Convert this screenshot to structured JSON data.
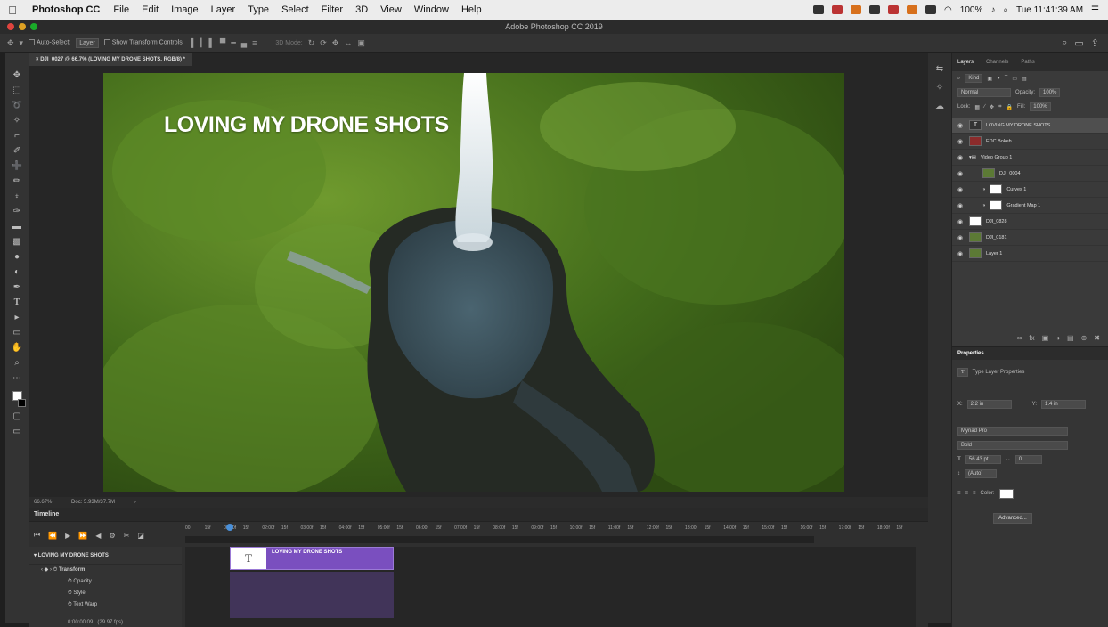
{
  "menubar": {
    "apple": "",
    "app_name": "Photoshop CC",
    "menus": [
      "File",
      "Edit",
      "Image",
      "Layer",
      "Type",
      "Select",
      "Filter",
      "3D",
      "View",
      "Window",
      "Help"
    ],
    "battery": "100%",
    "clock": "Tue 11:41:39 AM"
  },
  "window": {
    "title": "Adobe Photoshop CC 2019"
  },
  "options_bar": {
    "auto_select_label": "Auto-Select:",
    "auto_select_value": "Layer",
    "show_transform_label": "Show Transform Controls",
    "mode_3d": "3D Mode:"
  },
  "document_tab": {
    "title": "DJI_0027 @ 66.7% (LOVING MY DRONE SHOTS, RGB/8) *"
  },
  "canvas": {
    "overlay_text": "LOVING MY DRONE SHOTS",
    "colors": {
      "forest_dark": "#2d4a12",
      "forest_light": "#6f9a2e",
      "water": "#3f5560",
      "waterfall": "#e8eef0",
      "rock": "#2a2a28"
    }
  },
  "status": {
    "zoom": "66.67%",
    "doc_info": "Doc: 5.93M/37.7M"
  },
  "timeline": {
    "panel_title": "Timeline",
    "ruler_labels": [
      "00",
      "15f",
      "01:00f",
      "15f",
      "02:00f",
      "15f",
      "03:00f",
      "15f",
      "04:00f",
      "15f",
      "05:00f",
      "15f",
      "06:00f",
      "15f",
      "07:00f",
      "15f",
      "08:00f",
      "15f",
      "09:00f",
      "15f",
      "10:00f",
      "15f",
      "11:00f",
      "15f",
      "12:00f",
      "15f",
      "13:00f",
      "15f",
      "14:00f",
      "15f",
      "15:00f",
      "15f",
      "16:00f",
      "15f",
      "17:00f",
      "15f",
      "18:00f",
      "15f"
    ],
    "track_name": "LOVING MY DRONE SHOTS",
    "clip_label": "LOVING MY DRONE SHOTS",
    "properties": [
      "Transform",
      "Opacity",
      "Style",
      "Text Warp"
    ],
    "current_time": "0:00:00:09",
    "fps": "(29.97 fps)"
  },
  "layers_panel": {
    "tabs": [
      "Layers",
      "Channels",
      "Paths"
    ],
    "filter_kind": "Kind",
    "blend_mode": "Normal",
    "opacity_label": "Opacity:",
    "opacity_value": "100%",
    "lock_label": "Lock:",
    "fill_label": "Fill:",
    "fill_value": "100%",
    "layers": [
      {
        "name": "LOVING MY DRONE SHOTS",
        "thumb": "T",
        "selected": true
      },
      {
        "name": "EDC Bokeh",
        "thumb": "",
        "selected": false
      },
      {
        "name": "Video Group 1",
        "thumb": "",
        "selected": false
      },
      {
        "name": "DJI_0004",
        "thumb": "",
        "selected": false
      },
      {
        "name": "Curves 1",
        "thumb": "",
        "selected": false
      },
      {
        "name": "Gradient Map 1",
        "thumb": "",
        "selected": false
      },
      {
        "name": "DJI_0828",
        "thumb": "",
        "selected": false
      },
      {
        "name": "DJI_0181",
        "thumb": "",
        "selected": false
      },
      {
        "name": "Layer 1",
        "thumb": "",
        "selected": false
      }
    ]
  },
  "properties_panel": {
    "title": "Properties",
    "subtitle": "Type Layer Properties",
    "x_label": "X:",
    "x_value": "2.2 in",
    "y_label": "Y:",
    "y_value": "1.4 in",
    "font_family": "Myriad Pro",
    "font_style": "Bold",
    "font_size": "56.43 pt",
    "tracking": "0",
    "leading": "(Auto)",
    "color_label": "Color:",
    "color_value": "#ffffff",
    "advanced_button": "Advanced..."
  }
}
